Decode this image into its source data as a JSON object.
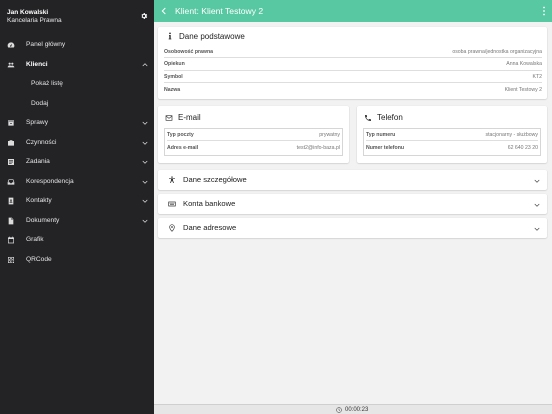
{
  "user": {
    "name": "Jan Kowalski",
    "company": "Kancelaria Prawna"
  },
  "sidebar": {
    "items": [
      {
        "label": "Panel główny"
      },
      {
        "label": "Klienci"
      },
      {
        "label": "Pokaż listę"
      },
      {
        "label": "Dodaj"
      },
      {
        "label": "Sprawy"
      },
      {
        "label": "Czynności"
      },
      {
        "label": "Zadania"
      },
      {
        "label": "Korespondencja"
      },
      {
        "label": "Kontakty"
      },
      {
        "label": "Dokumenty"
      },
      {
        "label": "Grafik"
      },
      {
        "label": "QRCode"
      }
    ]
  },
  "header": {
    "title": "Klient: Klient Testowy 2"
  },
  "basic": {
    "title": "Dane podstawowe",
    "rows": [
      {
        "key": "Osobowość prawna",
        "value": "osoba prawna/jednostka organizacyjna"
      },
      {
        "key": "Opiekun",
        "value": "Anna Kowalska"
      },
      {
        "key": "Symbol",
        "value": "KT2"
      },
      {
        "key": "Nazwa",
        "value": "Klient Testowy 2"
      }
    ]
  },
  "email": {
    "title": "E-mail",
    "rows": [
      {
        "key": "Typ poczty",
        "value": "prywatny"
      },
      {
        "key": "Adres e-mail",
        "value": "test2@info-baza.pl"
      }
    ]
  },
  "phone": {
    "title": "Telefon",
    "rows": [
      {
        "key": "Typ numeru",
        "value": "stacjonarny - służbowy"
      },
      {
        "key": "Numer telefonu",
        "value": "62 640 23 20"
      }
    ]
  },
  "accordions": [
    {
      "title": "Dane szczegółowe"
    },
    {
      "title": "Konta bankowe"
    },
    {
      "title": "Dane adresowe"
    }
  ],
  "footer": {
    "timer": "00:00:23"
  },
  "colors": {
    "header": "#57c8a2",
    "sidebar": "#232326",
    "background": "#f2f2f2"
  }
}
